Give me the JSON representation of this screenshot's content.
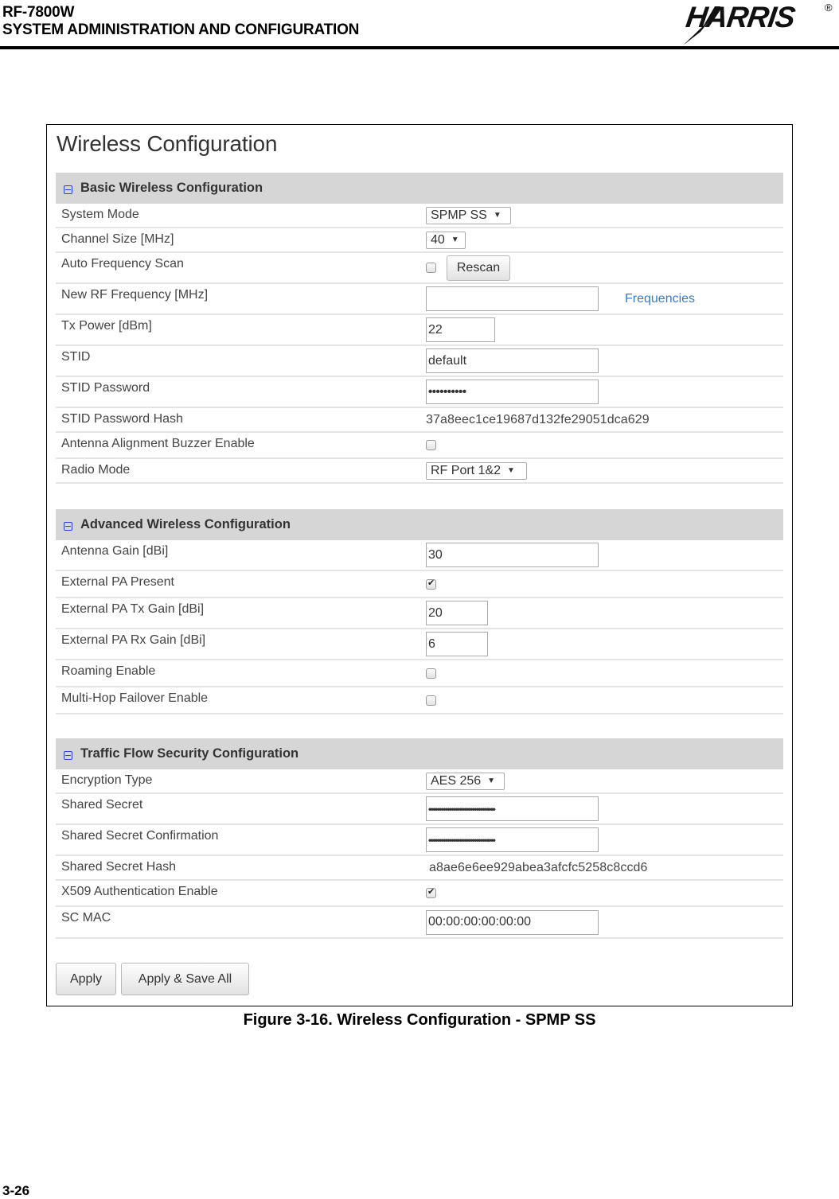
{
  "doc_header": {
    "product": "RF-7800W",
    "section": "SYSTEM ADMINISTRATION AND CONFIGURATION",
    "logo_text": "HARRIS",
    "logo_mark": "®"
  },
  "page": {
    "title": "Wireless Configuration"
  },
  "sections": {
    "basic": {
      "title": "Basic Wireless Configuration",
      "rows": {
        "system_mode": {
          "label": "System Mode",
          "value": "SPMP SS"
        },
        "channel_size": {
          "label": "Channel Size [MHz]",
          "value": "40"
        },
        "auto_freq_scan": {
          "label": "Auto Frequency Scan",
          "checked": false,
          "button": "Rescan"
        },
        "new_rf_freq": {
          "label": "New RF Frequency [MHz]",
          "value": "",
          "link": "Frequencies"
        },
        "tx_power": {
          "label": "Tx Power [dBm]",
          "value": "22"
        },
        "stid": {
          "label": "STID",
          "value": "default"
        },
        "stid_password": {
          "label": "STID Password",
          "value": "••••••••••"
        },
        "stid_password_hash": {
          "label": "STID Password Hash",
          "value": "37a8eec1ce19687d132fe29051dca629"
        },
        "buzzer": {
          "label": "Antenna Alignment Buzzer Enable",
          "checked": false
        },
        "radio_mode": {
          "label": "Radio Mode",
          "value": "RF Port 1&2"
        }
      }
    },
    "advanced": {
      "title": "Advanced Wireless Configuration",
      "rows": {
        "antenna_gain": {
          "label": "Antenna Gain [dBi]",
          "value": "30"
        },
        "ext_pa_present": {
          "label": "External PA Present",
          "checked": true
        },
        "ext_pa_tx_gain": {
          "label": "External PA Tx Gain [dBi]",
          "value": "20"
        },
        "ext_pa_rx_gain": {
          "label": "External PA Rx Gain [dBi]",
          "value": "6"
        },
        "roaming": {
          "label": "Roaming Enable",
          "checked": false
        },
        "multihop": {
          "label": "Multi-Hop Failover Enable",
          "checked": false
        }
      }
    },
    "security": {
      "title": "Traffic Flow Security Configuration",
      "rows": {
        "encryption_type": {
          "label": "Encryption Type",
          "value": "AES 256"
        },
        "shared_secret": {
          "label": "Shared Secret",
          "value": "••••••••••••••••••••••••••••••••"
        },
        "shared_secret_confirm": {
          "label": "Shared Secret Confirmation",
          "value": "••••••••••••••••••••••••••••••••"
        },
        "shared_secret_hash": {
          "label": "Shared Secret Hash",
          "value": "a8ae6e6ee929abea3afcfc5258c8ccd6"
        },
        "x509": {
          "label": "X509 Authentication Enable",
          "checked": true
        },
        "sc_mac": {
          "label": "SC MAC",
          "value": "00:00:00:00:00:00"
        }
      }
    }
  },
  "buttons": {
    "apply": "Apply",
    "apply_save_all": "Apply & Save All"
  },
  "caption": "Figure 3-16.  Wireless Configuration - SPMP SS",
  "page_number": "3-26",
  "colors": {
    "section_header_bg": "#d6d6d6",
    "collapse_icon": "#2b3fd6",
    "link": "#3b7bc4"
  }
}
